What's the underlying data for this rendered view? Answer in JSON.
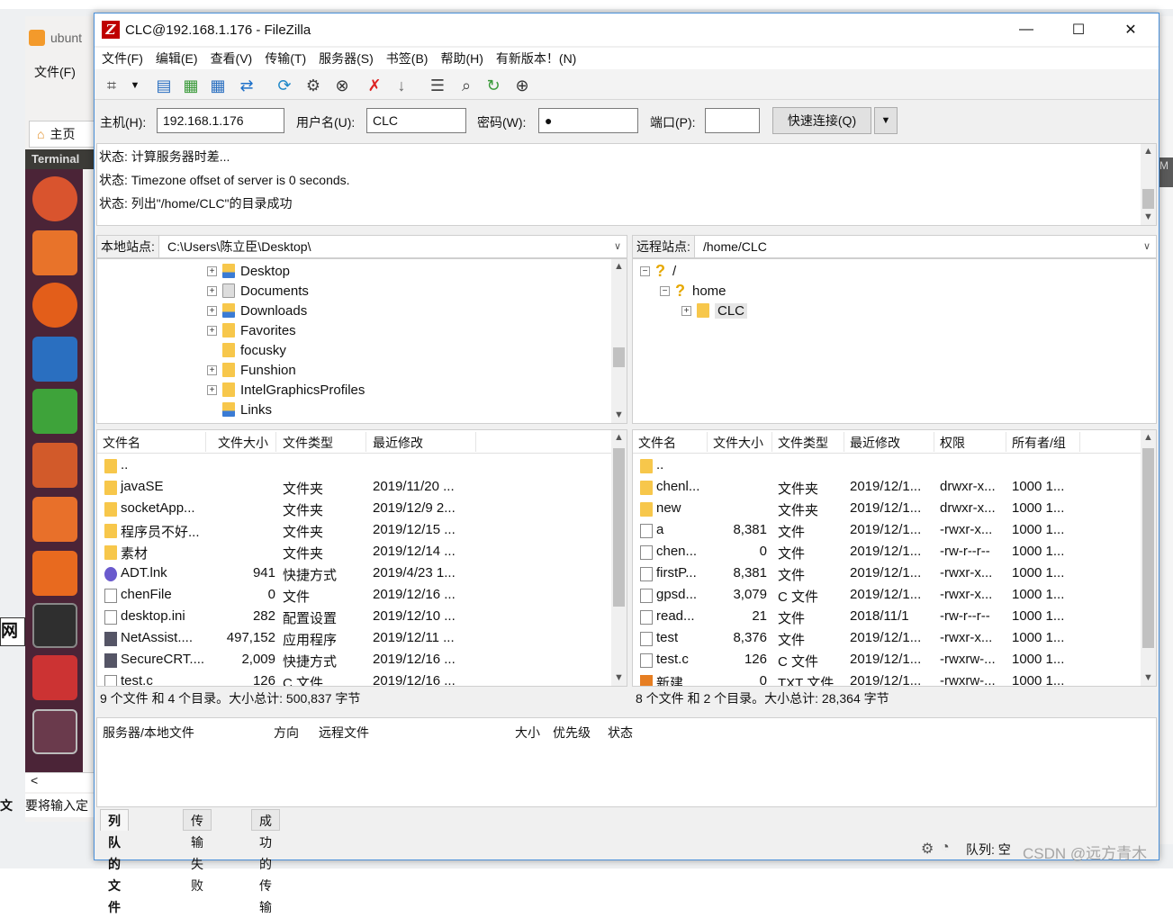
{
  "background": {
    "tab_label": "ubunt",
    "menu_label": "文件(F)",
    "home_label": "主页",
    "terminal_label": "Terminal",
    "status_fragment": "要将输入定",
    "left_fragment": "网",
    "left_fragment2": "文",
    "right_fragment": "M"
  },
  "window": {
    "title": "CLC@192.168.1.176 - FileZilla",
    "app_icon": "Z"
  },
  "menu": [
    "文件(F)",
    "编辑(E)",
    "查看(V)",
    "传输(T)",
    "服务器(S)",
    "书签(B)",
    "帮助(H)",
    "有新版本！(N)"
  ],
  "quickconnect": {
    "host_label": "主机(H):",
    "host_value": "192.168.1.176",
    "user_label": "用户名(U):",
    "user_value": "CLC",
    "pass_label": "密码(W):",
    "pass_value": "●",
    "port_label": "端口(P):",
    "port_value": "",
    "connect_label": "快速连接(Q)"
  },
  "log": [
    "状态: 计算服务器时差...",
    "状态: Timezone offset of server is 0 seconds.",
    "状态: 列出\"/home/CLC\"的目录成功"
  ],
  "local": {
    "site_label": "本地站点:",
    "site_path": "C:\\Users\\陈立臣\\Desktop\\",
    "tree": [
      "Desktop",
      "Documents",
      "Downloads",
      "Favorites",
      "focusky",
      "Funshion",
      "IntelGraphicsProfiles",
      "Links"
    ],
    "headers": [
      "文件名",
      "文件大小",
      "文件类型",
      "最近修改"
    ],
    "files": [
      {
        "name": "..",
        "size": "",
        "type": "",
        "modified": "",
        "icon": "folder"
      },
      {
        "name": "javaSE",
        "size": "",
        "type": "文件夹",
        "modified": "2019/11/20 ...",
        "icon": "folder"
      },
      {
        "name": "socketApp...",
        "size": "",
        "type": "文件夹",
        "modified": "2019/12/9 2...",
        "icon": "folder"
      },
      {
        "name": "程序员不好...",
        "size": "",
        "type": "文件夹",
        "modified": "2019/12/15 ...",
        "icon": "folder"
      },
      {
        "name": "素材",
        "size": "",
        "type": "文件夹",
        "modified": "2019/12/14 ...",
        "icon": "folder"
      },
      {
        "name": "ADT.lnk",
        "size": "941",
        "type": "快捷方式",
        "modified": "2019/4/23 1...",
        "icon": "lnk"
      },
      {
        "name": "chenFile",
        "size": "0",
        "type": "文件",
        "modified": "2019/12/16 ...",
        "icon": "doc"
      },
      {
        "name": "desktop.ini",
        "size": "282",
        "type": "配置设置",
        "modified": "2019/12/10 ...",
        "icon": "doc"
      },
      {
        "name": "NetAssist....",
        "size": "497,152",
        "type": "应用程序",
        "modified": "2019/12/11 ...",
        "icon": "exe"
      },
      {
        "name": "SecureCRT....",
        "size": "2,009",
        "type": "快捷方式",
        "modified": "2019/12/16 ...",
        "icon": "exe"
      },
      {
        "name": "test.c",
        "size": "126",
        "type": "C 文件",
        "modified": "2019/12/16 ...",
        "icon": "doc"
      }
    ],
    "summary": "9 个文件 和 4 个目录。大小总计: 500,837 字节"
  },
  "remote": {
    "site_label": "远程站点:",
    "site_path": "/home/CLC",
    "tree": [
      "/",
      "home",
      "CLC"
    ],
    "headers": [
      "文件名",
      "文件大小",
      "文件类型",
      "最近修改",
      "权限",
      "所有者/组"
    ],
    "files": [
      {
        "name": "..",
        "size": "",
        "type": "",
        "modified": "",
        "perm": "",
        "owner": "",
        "icon": "folder"
      },
      {
        "name": "chenl...",
        "size": "",
        "type": "文件夹",
        "modified": "2019/12/1...",
        "perm": "drwxr-x...",
        "owner": "1000 1...",
        "icon": "folder"
      },
      {
        "name": "new",
        "size": "",
        "type": "文件夹",
        "modified": "2019/12/1...",
        "perm": "drwxr-x...",
        "owner": "1000 1...",
        "icon": "folder"
      },
      {
        "name": "a",
        "size": "8,381",
        "type": "文件",
        "modified": "2019/12/1...",
        "perm": "-rwxr-x...",
        "owner": "1000 1...",
        "icon": "doc"
      },
      {
        "name": "chen...",
        "size": "0",
        "type": "文件",
        "modified": "2019/12/1...",
        "perm": "-rw-r--r--",
        "owner": "1000 1...",
        "icon": "doc"
      },
      {
        "name": "firstP...",
        "size": "8,381",
        "type": "文件",
        "modified": "2019/12/1...",
        "perm": "-rwxr-x...",
        "owner": "1000 1...",
        "icon": "doc"
      },
      {
        "name": "gpsd...",
        "size": "3,079",
        "type": "C 文件",
        "modified": "2019/12/1...",
        "perm": "-rwxr-x...",
        "owner": "1000 1...",
        "icon": "doc"
      },
      {
        "name": "read...",
        "size": "21",
        "type": "文件",
        "modified": "2018/11/1",
        "perm": "-rw-r--r--",
        "owner": "1000 1...",
        "icon": "doc"
      },
      {
        "name": "test",
        "size": "8,376",
        "type": "文件",
        "modified": "2019/12/1...",
        "perm": "-rwxr-x...",
        "owner": "1000 1...",
        "icon": "doc"
      },
      {
        "name": "test.c",
        "size": "126",
        "type": "C 文件",
        "modified": "2019/12/1...",
        "perm": "-rwxrw-...",
        "owner": "1000 1...",
        "icon": "doc"
      },
      {
        "name": "新建...",
        "size": "0",
        "type": "TXT 文件",
        "modified": "2019/12/1...",
        "perm": "-rwxrw-...",
        "owner": "1000 1...",
        "icon": "txt"
      }
    ],
    "summary": "8 个文件 和 2 个目录。大小总计: 28,364 字节"
  },
  "queue": {
    "headers": [
      "服务器/本地文件",
      "方向",
      "远程文件",
      "大小",
      "优先级",
      "状态"
    ],
    "tabs": [
      "列队的文件",
      "传输失败",
      "成功的传输"
    ]
  },
  "statusbar": {
    "queue_label": "队列: 空"
  },
  "watermark": "CSDN @远方青木"
}
